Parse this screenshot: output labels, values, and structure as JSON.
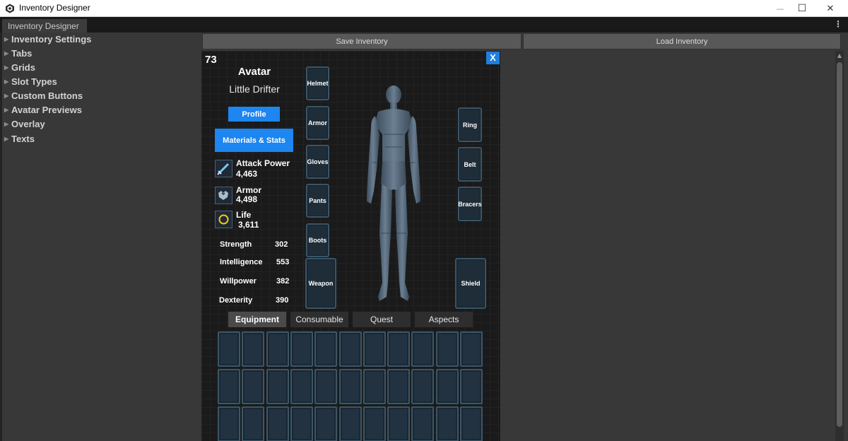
{
  "window": {
    "title": "Inventory Designer"
  },
  "tab": {
    "label": "Inventory Designer",
    "menu_glyph": "⋮"
  },
  "window_controls": {
    "minimize": "—",
    "maximize": "☐",
    "close": "✕"
  },
  "sidebar": {
    "items": [
      {
        "label": "Inventory Settings"
      },
      {
        "label": "Tabs"
      },
      {
        "label": "Grids"
      },
      {
        "label": "Slot Types"
      },
      {
        "label": "Custom Buttons"
      },
      {
        "label": "Avatar Previews"
      },
      {
        "label": "Overlay"
      },
      {
        "label": "Texts"
      }
    ],
    "arrow_glyph": "▶"
  },
  "toolbar": {
    "save_label": "Save Inventory",
    "load_label": "Load Inventory"
  },
  "inventory": {
    "level": "73",
    "close_label": "X",
    "avatar_title": "Avatar",
    "avatar_name": "Little Drifter",
    "profile_label": "Profile",
    "materials_label": "Materials & Stats",
    "stats": [
      {
        "label": "Attack Power",
        "value": "4,463",
        "icon": "sword-icon"
      },
      {
        "label": "Armor",
        "value": "4,498",
        "icon": "armor-icon"
      },
      {
        "label": "Life",
        "value": "3,611",
        "icon": "life-ring-icon"
      }
    ],
    "attributes": [
      {
        "name": "Strength",
        "value": "302"
      },
      {
        "name": "Intelligence",
        "value": "553"
      },
      {
        "name": "Willpower",
        "value": "382"
      },
      {
        "name": "Dexterity",
        "value": "390"
      }
    ],
    "left_slots": [
      "Helmet",
      "Armor",
      "Gloves",
      "Pants",
      "Boots",
      "Weapon"
    ],
    "right_slots": [
      "Ring",
      "Belt",
      "Bracers",
      "Shield"
    ],
    "tabs": [
      {
        "label": "Equipment",
        "active": true
      },
      {
        "label": "Consumable",
        "active": false
      },
      {
        "label": "Quest",
        "active": false
      },
      {
        "label": "Aspects",
        "active": false
      }
    ],
    "grid": {
      "columns": 11,
      "rows": 3
    }
  },
  "colors": {
    "accent_blue": "#1d86f0",
    "slot_border": "#3a5568",
    "panel_bg": "#1a1a1a",
    "editor_bg": "#383838"
  }
}
